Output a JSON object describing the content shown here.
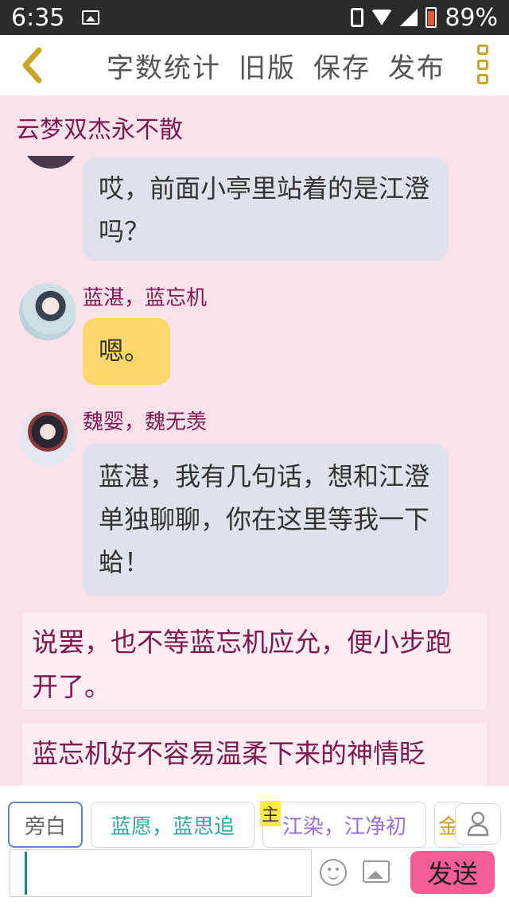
{
  "status": {
    "time": "6:35",
    "battery": "89%"
  },
  "toolbar": {
    "word_count": "字数统计",
    "old_version": "旧版",
    "save": "保存",
    "publish": "发布"
  },
  "story_title": "云梦双杰永不散",
  "messages": [
    {
      "text": "哎，前面小亭里站着的是江澄吗？"
    },
    {
      "speaker": "蓝湛，蓝忘机",
      "text": "嗯。"
    },
    {
      "speaker": "魏婴，魏无羡",
      "text": "蓝湛，我有几句话，想和江澄单独聊聊，你在这里等我一下蛤！"
    }
  ],
  "narration": [
    "说罢，也不等蓝忘机应允，便小步跑开了。",
    "蓝忘机好不容易温柔下来的神情眨"
  ],
  "roles": {
    "narrator": "旁白",
    "role1": "蓝愿，蓝思追",
    "role2_badge": "主",
    "role2": "江染，江净初",
    "role3": "金"
  },
  "input": {
    "send": "发送"
  }
}
